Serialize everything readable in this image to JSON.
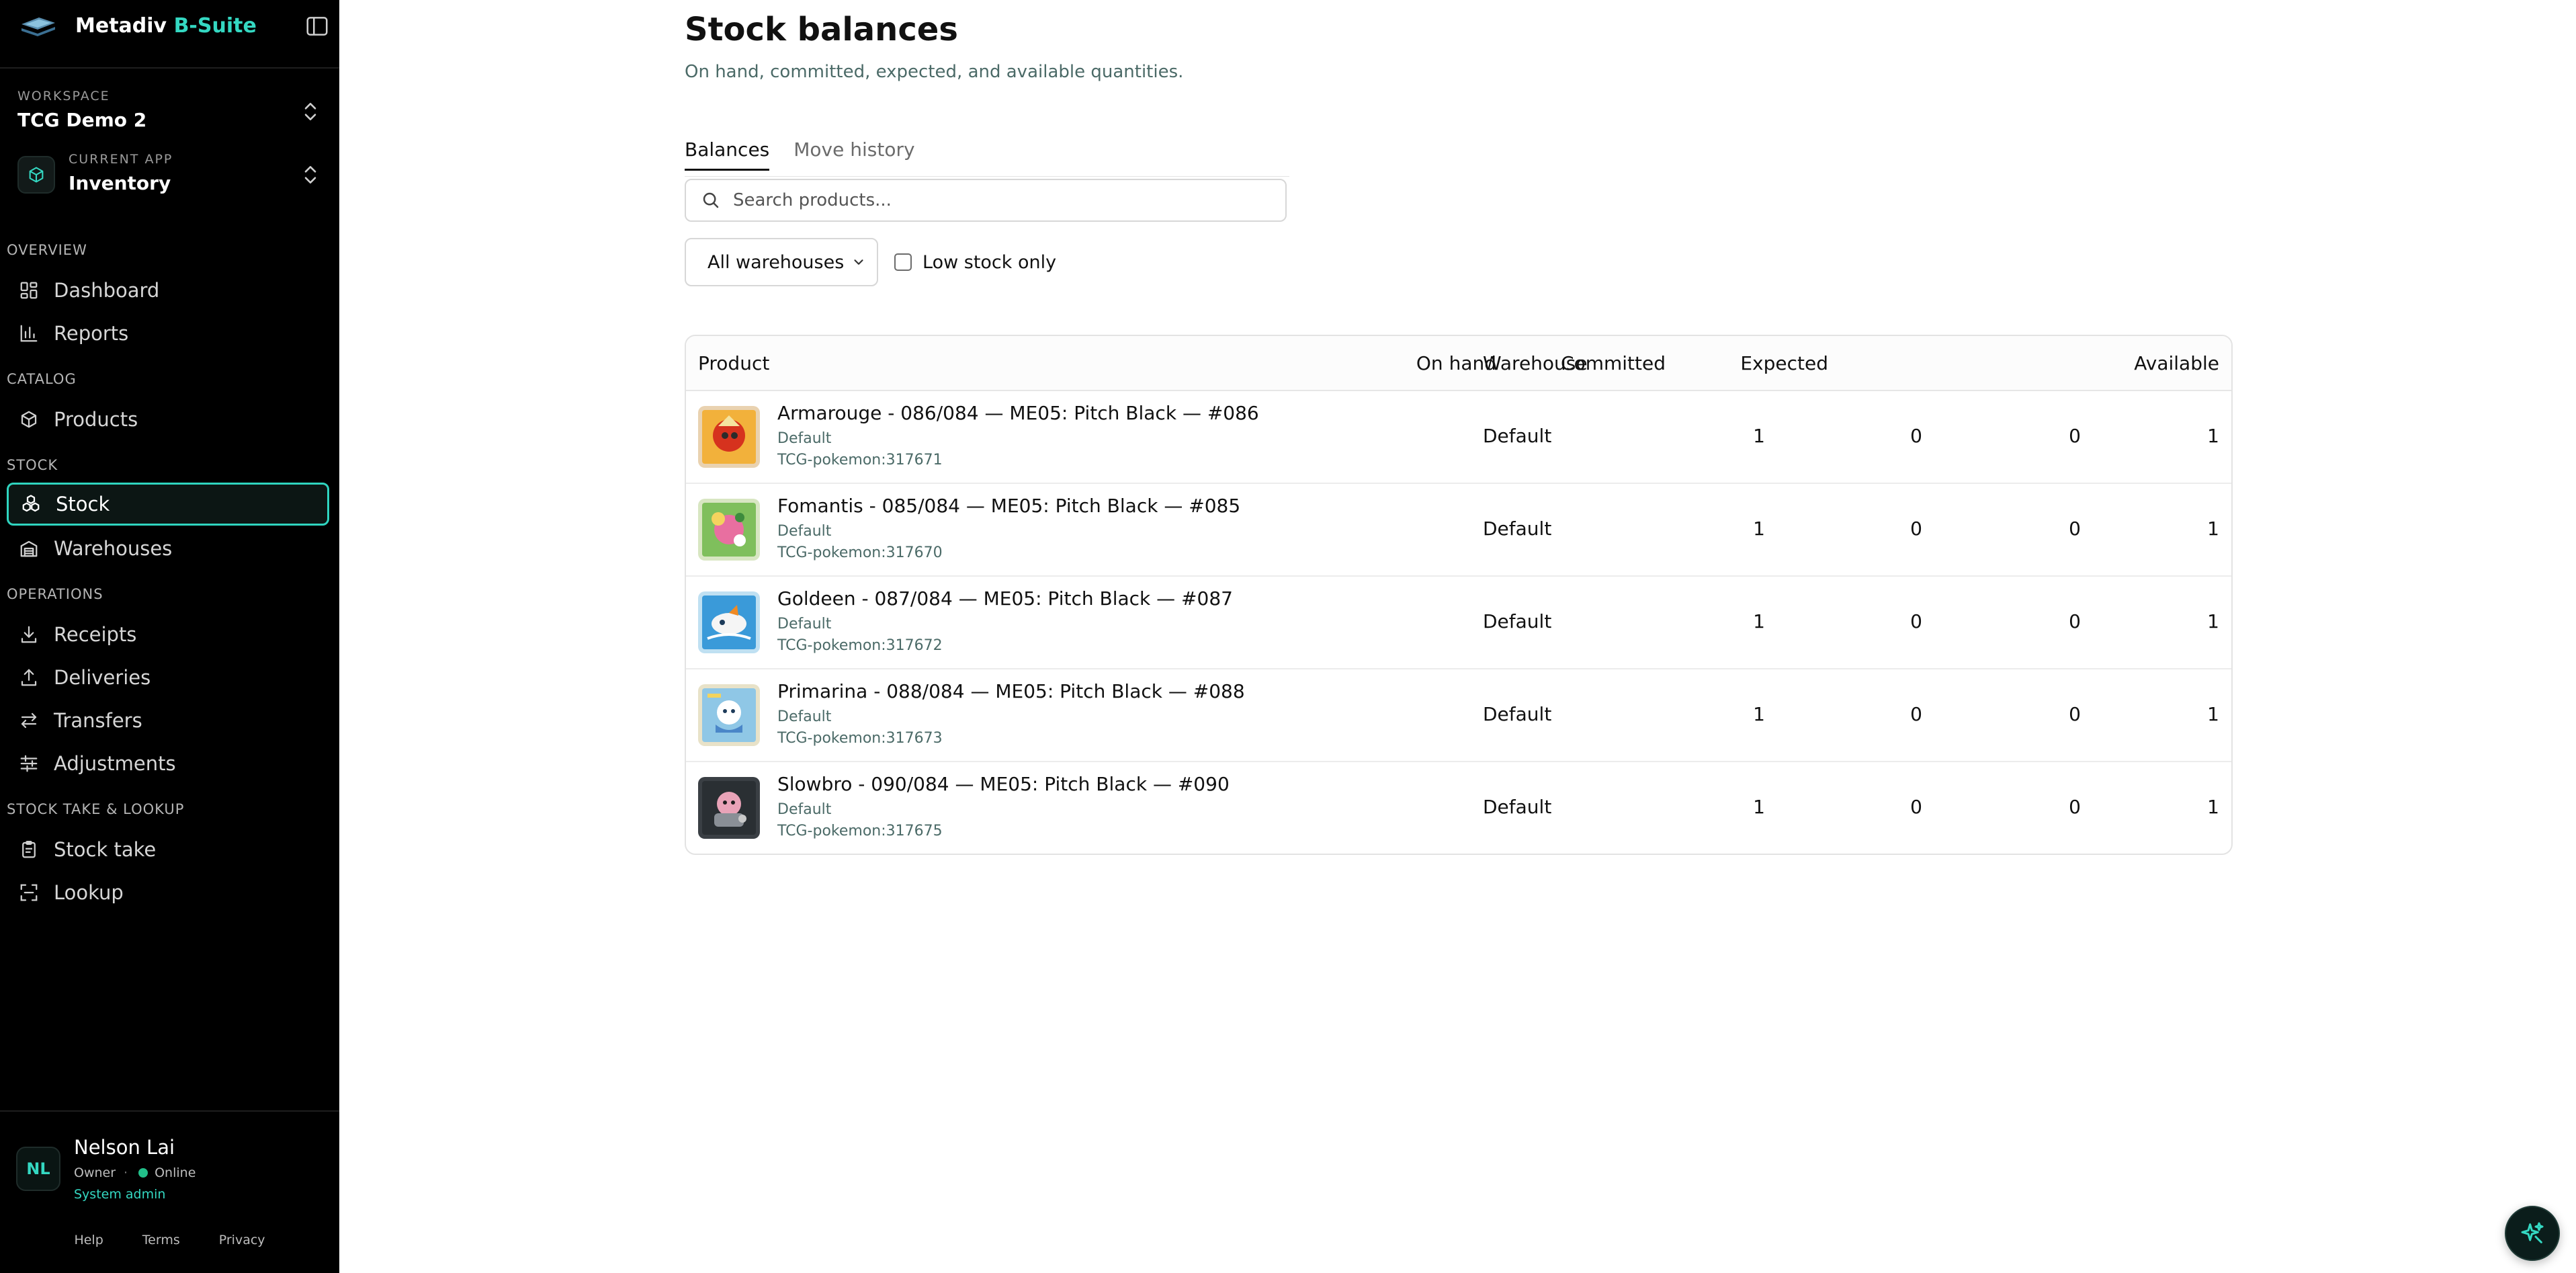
{
  "brand": {
    "name": "Metadiv",
    "suffix": "B-Suite"
  },
  "workspace": {
    "caption": "Workspace",
    "value": "TCG Demo 2"
  },
  "current_app": {
    "caption": "Current app",
    "value": "Inventory"
  },
  "nav": {
    "overview": {
      "label": "Overview",
      "items": [
        {
          "label": "Dashboard",
          "icon": "dashboard-icon"
        },
        {
          "label": "Reports",
          "icon": "bar-chart-icon"
        }
      ]
    },
    "catalog": {
      "label": "Catalog",
      "items": [
        {
          "label": "Products",
          "icon": "package-icon"
        }
      ]
    },
    "stock": {
      "label": "Stock",
      "items": [
        {
          "label": "Stock",
          "icon": "boxes-icon",
          "active": true
        },
        {
          "label": "Warehouses",
          "icon": "warehouse-icon"
        }
      ]
    },
    "operations": {
      "label": "Operations",
      "items": [
        {
          "label": "Receipts",
          "icon": "download-icon"
        },
        {
          "label": "Deliveries",
          "icon": "upload-icon"
        },
        {
          "label": "Transfers",
          "icon": "transfer-icon"
        },
        {
          "label": "Adjustments",
          "icon": "sliders-icon"
        }
      ]
    },
    "stocktake": {
      "label": "Stock take & lookup",
      "items": [
        {
          "label": "Stock take",
          "icon": "clipboard-icon"
        },
        {
          "label": "Lookup",
          "icon": "scan-icon"
        }
      ]
    }
  },
  "user": {
    "initials": "NL",
    "name": "Nelson Lai",
    "role": "Owner",
    "separator": "·",
    "status": "Online",
    "badge": "System admin"
  },
  "footer": {
    "help": "Help",
    "terms": "Terms",
    "privacy": "Privacy"
  },
  "page": {
    "title": "Stock balances",
    "subtitle": "On hand, committed, expected, and available quantities."
  },
  "tabs": {
    "balances": "Balances",
    "history": "Move history"
  },
  "search": {
    "placeholder": "Search products..."
  },
  "filters": {
    "warehouse": "All warehouses",
    "low_stock": "Low stock only"
  },
  "table": {
    "columns": {
      "product": "Product",
      "warehouse": "Warehouse",
      "on_hand": "On hand",
      "committed": "Committed",
      "expected": "Expected",
      "available": "Available"
    },
    "rows": [
      {
        "name": "Armarouge - 086/084 — ME05: Pitch Black — #086",
        "variant": "Default",
        "sku": "TCG-pokemon:317671",
        "warehouse": "Default",
        "on_hand": "1",
        "committed": "0",
        "expected": "0",
        "available": "1"
      },
      {
        "name": "Fomantis - 085/084 — ME05: Pitch Black — #085",
        "variant": "Default",
        "sku": "TCG-pokemon:317670",
        "warehouse": "Default",
        "on_hand": "1",
        "committed": "0",
        "expected": "0",
        "available": "1"
      },
      {
        "name": "Goldeen - 087/084 — ME05: Pitch Black — #087",
        "variant": "Default",
        "sku": "TCG-pokemon:317672",
        "warehouse": "Default",
        "on_hand": "1",
        "committed": "0",
        "expected": "0",
        "available": "1"
      },
      {
        "name": "Primarina - 088/084 — ME05: Pitch Black — #088",
        "variant": "Default",
        "sku": "TCG-pokemon:317673",
        "warehouse": "Default",
        "on_hand": "1",
        "committed": "0",
        "expected": "0",
        "available": "1"
      },
      {
        "name": "Slowbro - 090/084 — ME05: Pitch Black — #090",
        "variant": "Default",
        "sku": "TCG-pokemon:317675",
        "warehouse": "Default",
        "on_hand": "1",
        "committed": "0",
        "expected": "0",
        "available": "1"
      }
    ]
  },
  "colors": {
    "accent": "#34d8c2",
    "sidebar_bg": "#000000",
    "online": "#22c08a"
  }
}
